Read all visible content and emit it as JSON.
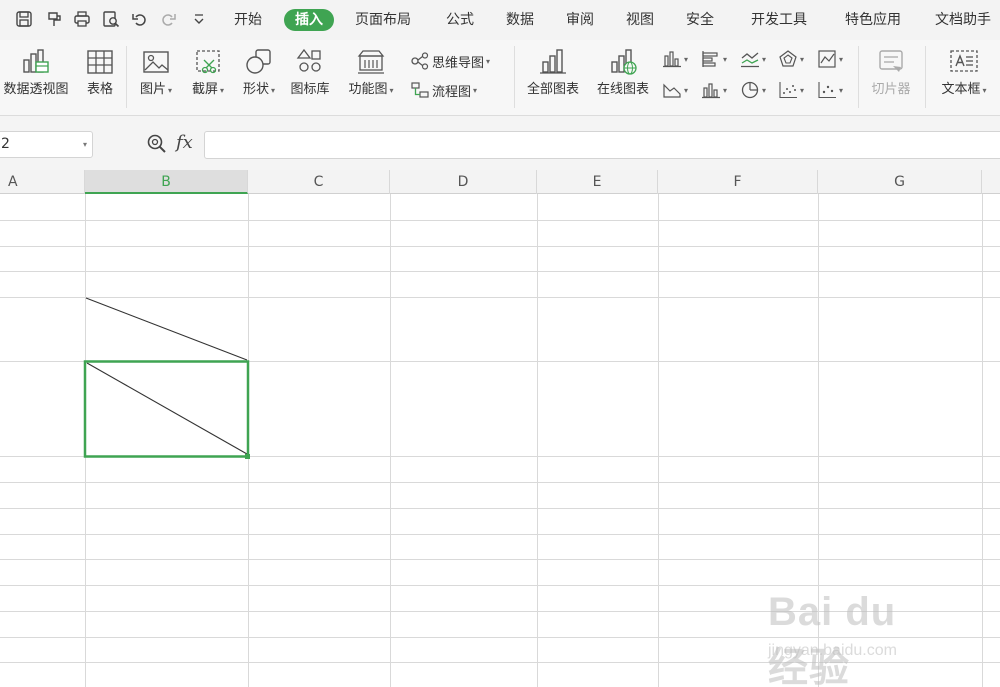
{
  "menu": {
    "tabs": [
      "开始",
      "插入",
      "页面布局",
      "公式",
      "数据",
      "审阅",
      "视图",
      "安全",
      "开发工具",
      "特色应用",
      "文档助手"
    ],
    "active_index": 1,
    "accent_color": "#3fa452"
  },
  "quick_access": [
    "save-icon",
    "redo-style-icon",
    "print-icon",
    "print-preview-icon",
    "undo-icon",
    "redo-icon",
    "customize-icon"
  ],
  "ribbon": {
    "pivot": "数据透视图",
    "table": "表格",
    "picture": "图片",
    "screenshot": "截屏",
    "shape": "形状",
    "icon_library": "图标库",
    "function_chart": "功能图",
    "mind_map": "思维导图",
    "flowchart": "流程图",
    "all_charts": "全部图表",
    "online_charts": "在线图表",
    "slicer": "切片器",
    "textbox": "文本框"
  },
  "formula_bar": {
    "name_box": "2",
    "fx": "fx",
    "formula": ""
  },
  "columns": [
    "A",
    "B",
    "C",
    "D",
    "E",
    "F",
    "G"
  ],
  "selected_column": "B",
  "watermark": {
    "logo": "Bai du 经验",
    "url": "jingyan.baidu.com"
  }
}
